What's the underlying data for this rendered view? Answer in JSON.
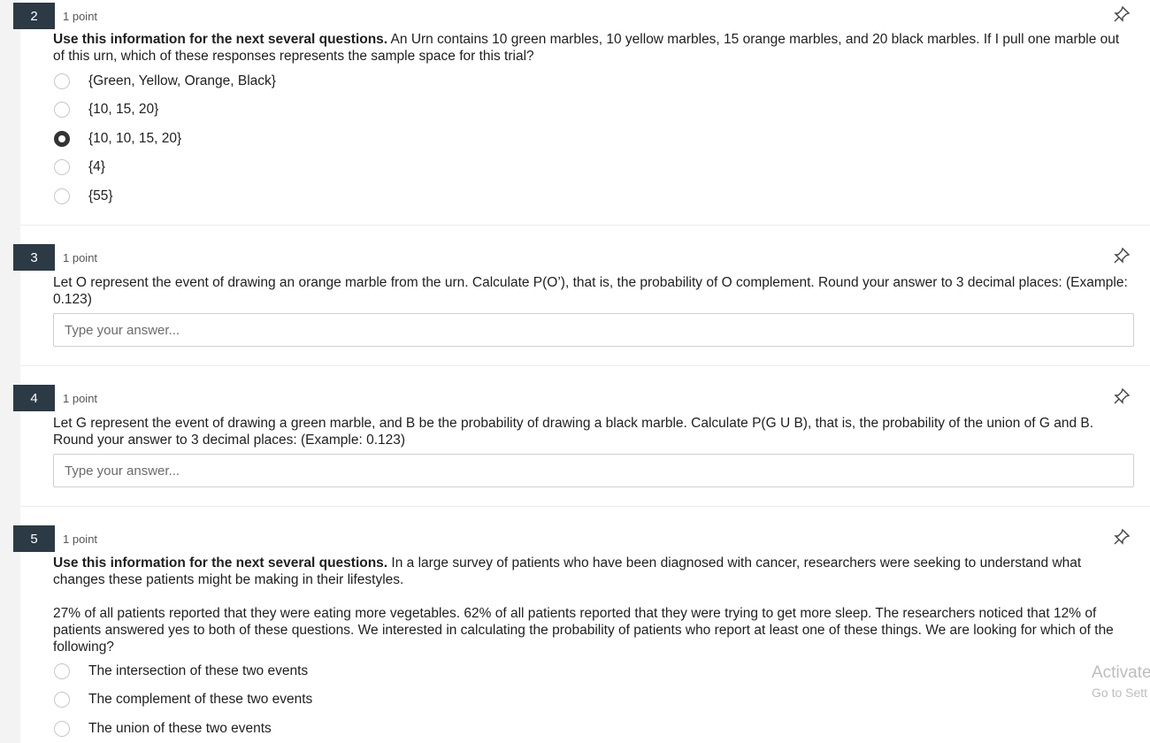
{
  "questions": [
    {
      "number": "2",
      "points": "1 point",
      "lead": "Use this information for the next several questions.",
      "text": " An Urn contains 10 green marbles, 10 yellow marbles, 15 orange marbles, and 20 black marbles. If I pull one marble out of this urn, which of these responses represents the sample space for this trial?",
      "options": [
        {
          "label": "{Green, Yellow, Orange, Black}",
          "selected": false
        },
        {
          "label": "{10, 15, 20}",
          "selected": false
        },
        {
          "label": "{10, 10, 15, 20}",
          "selected": true
        },
        {
          "label": " {4}",
          "selected": false
        },
        {
          "label": "{55}",
          "selected": false
        }
      ]
    },
    {
      "number": "3",
      "points": "1 point",
      "text": "Let O represent the event of drawing an orange marble from the urn. Calculate P(O’), that is, the probability of O complement. Round your answer to 3 decimal places: (Example: 0.123)",
      "placeholder": "Type your answer..."
    },
    {
      "number": "4",
      "points": "1 point",
      "text": "Let G represent the event of drawing a green marble, and B be the probability of drawing a black marble. Calculate P(G U B), that is, the probability of the union of G and B. Round your answer to 3 decimal places: (Example: 0.123)",
      "placeholder": "Type your answer..."
    },
    {
      "number": "5",
      "points": "1 point",
      "lead": "Use this information for the next several questions.",
      "text": " In a large survey of patients who have been diagnosed with cancer, researchers were seeking to understand what changes these patients might be making in their lifestyles.",
      "text2": "27% of all patients reported that they were eating more vegetables. 62% of all patients reported that they were trying to get more sleep. The researchers noticed that 12% of patients answered yes to both of these questions. We interested in calculating the probability of patients who report at least one of these things. We are looking for which of the following?",
      "options": [
        {
          "label": "The intersection of these two events",
          "selected": false
        },
        {
          "label": "The complement of these two events",
          "selected": false
        },
        {
          "label": "The union of these two events",
          "selected": false
        }
      ]
    }
  ],
  "watermark": {
    "line1": "Activate",
    "line2": "Go to Sett"
  },
  "icons": {
    "pin": "pin-icon",
    "radio": "radio-button"
  }
}
